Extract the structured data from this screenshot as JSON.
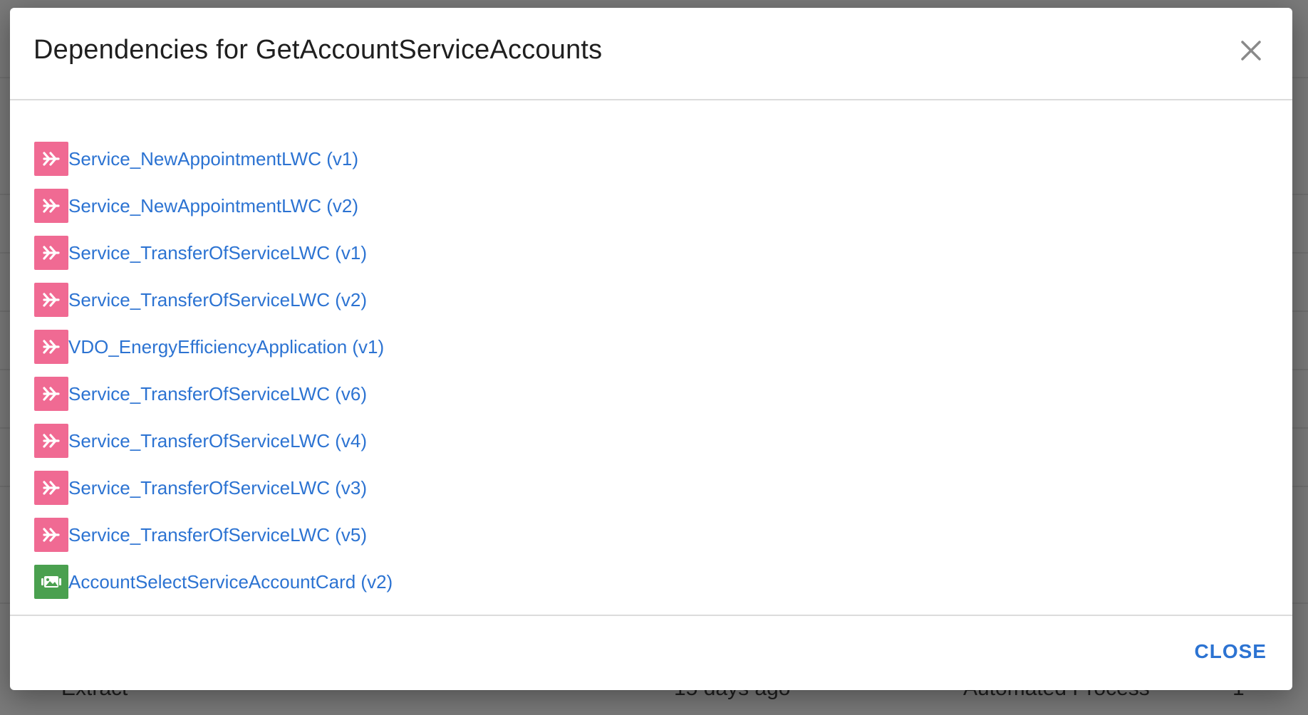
{
  "background": {
    "row": {
      "name": "Extract",
      "modified": "15 days ago",
      "by": "Automated Process",
      "count": "1"
    }
  },
  "modal": {
    "title": "Dependencies for GetAccountServiceAccounts",
    "close_icon": "close-icon",
    "footer": {
      "close_label": "CLOSE"
    },
    "dependencies": [
      {
        "label": "Service_NewAppointmentLWC (v1)",
        "icon": "omniscript-icon",
        "color": "#f06a93"
      },
      {
        "label": "Service_NewAppointmentLWC (v2)",
        "icon": "omniscript-icon",
        "color": "#f06a93"
      },
      {
        "label": "Service_TransferOfServiceLWC (v1)",
        "icon": "omniscript-icon",
        "color": "#f06a93"
      },
      {
        "label": "Service_TransferOfServiceLWC (v2)",
        "icon": "omniscript-icon",
        "color": "#f06a93"
      },
      {
        "label": "VDO_EnergyEfficiencyApplication (v1)",
        "icon": "omniscript-icon",
        "color": "#f06a93"
      },
      {
        "label": "Service_TransferOfServiceLWC (v6)",
        "icon": "omniscript-icon",
        "color": "#f06a93"
      },
      {
        "label": "Service_TransferOfServiceLWC (v4)",
        "icon": "omniscript-icon",
        "color": "#f06a93"
      },
      {
        "label": "Service_TransferOfServiceLWC (v3)",
        "icon": "omniscript-icon",
        "color": "#f06a93"
      },
      {
        "label": "Service_TransferOfServiceLWC (v5)",
        "icon": "omniscript-icon",
        "color": "#f06a93"
      },
      {
        "label": "AccountSelectServiceAccountCard (v2)",
        "icon": "flexcard-icon",
        "color": "#4aa04f"
      }
    ]
  },
  "colors": {
    "link": "#2c73d2",
    "title": "#1f1f1f"
  }
}
